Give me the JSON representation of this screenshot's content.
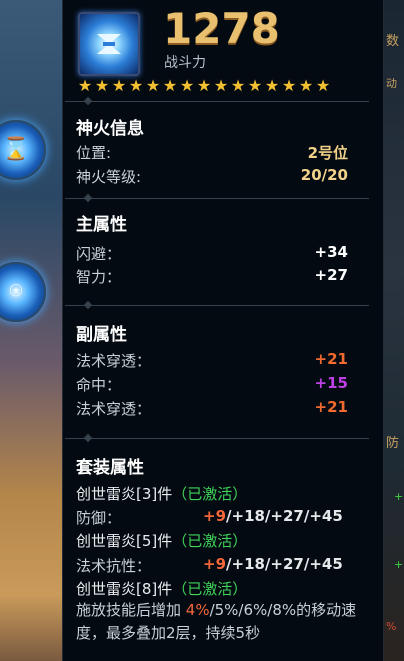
{
  "background": {
    "right_fragments": [
      "数",
      "动",
      "防"
    ],
    "right_pcts": [
      "%",
      "%"
    ]
  },
  "item": {
    "power": "1278",
    "power_label": "战斗力",
    "stars": 15
  },
  "section_fire": {
    "title": "神火信息",
    "rows": [
      {
        "label": "位置:",
        "value": "2号位",
        "color": "#f2d28a"
      },
      {
        "label": "神火等级:",
        "value": "20/20",
        "color": "#f2d28a"
      }
    ]
  },
  "section_main": {
    "title": "主属性",
    "rows": [
      {
        "label": "闪避：",
        "value": "+34",
        "color": "#ffffff"
      },
      {
        "label": "智力：",
        "value": "+27",
        "color": "#ffffff"
      }
    ]
  },
  "section_sub": {
    "title": "副属性",
    "rows": [
      {
        "label": "法术穿透：",
        "value": "+21",
        "color": "#f26a2e"
      },
      {
        "label": "命中：",
        "value": "+15",
        "color": "#c040e8"
      },
      {
        "label": "法术穿透：",
        "value": "+21",
        "color": "#f26a2e"
      }
    ]
  },
  "section_set": {
    "title": "套装属性",
    "set3": {
      "name": "创世雷炎[3]件",
      "status": "（已激活）"
    },
    "stat1": {
      "label": "防御：",
      "first": "+9",
      "rest": "/+18/+27/+45"
    },
    "set5": {
      "name": "创世雷炎[5]件",
      "status": "（已激活）"
    },
    "stat2": {
      "label": "法术抗性：",
      "first": "+9",
      "rest": "/+18/+27/+45"
    },
    "set8": {
      "name": "创世雷炎[8]件",
      "status": "（已激活）"
    },
    "desc_a": "施放技能后增加 ",
    "desc_hl": "4%",
    "desc_b": "/5%/6%/8%的移动速度，最多叠加2层，持续5秒"
  },
  "colors": {
    "gold": "#e9c070",
    "active_green": "#3ed35a",
    "orange": "#f26a2e",
    "purple": "#c040e8"
  },
  "icons": [
    "thunder-fire-item-icon",
    "star-icon",
    "skill-orb-icon"
  ]
}
